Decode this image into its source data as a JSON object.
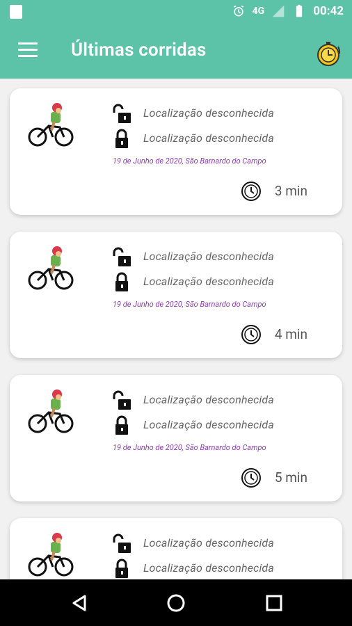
{
  "status": {
    "time": "00:42",
    "network": "4G"
  },
  "appbar": {
    "title": "Últimas corridas"
  },
  "rides": [
    {
      "start": "Localização desconhecida",
      "end": "Localização desconhecida",
      "date_place": "19 de Junho de 2020, São Barnardo do Campo",
      "duration": "3 min"
    },
    {
      "start": "Localização desconhecida",
      "end": "Localização desconhecida",
      "date_place": "19 de Junho de 2020, São Barnardo do Campo",
      "duration": "4 min"
    },
    {
      "start": "Localização desconhecida",
      "end": "Localização desconhecida",
      "date_place": "19 de Junho de 2020, São Barnardo do Campo",
      "duration": "5 min"
    },
    {
      "start": "Localização desconhecida",
      "end": "Localização desconhecida"
    }
  ],
  "colors": {
    "accent": "#5cc2a8",
    "date": "#8e3cb4"
  },
  "icons": [
    "menu-icon",
    "stopwatch-icon",
    "bicycle-icon",
    "unlock-icon",
    "lock-icon",
    "clock-icon",
    "back-icon",
    "home-icon",
    "recents-icon"
  ]
}
